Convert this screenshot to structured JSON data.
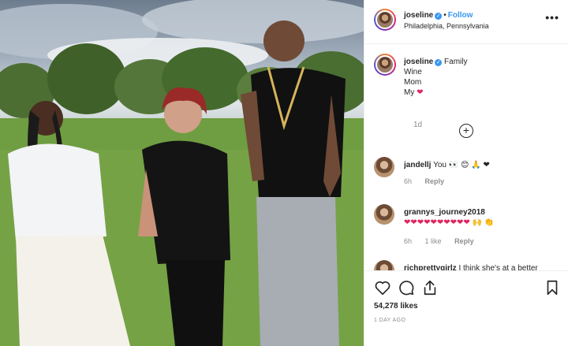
{
  "post": {
    "username": "joseline",
    "follow_label": "Follow",
    "location": "Philadelphia, Pennsylvania",
    "more_icon": "more-horizontal-icon",
    "verified_icon": "verified-badge-icon"
  },
  "caption": {
    "username": "joseline",
    "lines": [
      "Family",
      "Wine",
      "Mom",
      "My"
    ],
    "heart": "❤",
    "time": "1d",
    "load_more_icon": "plus-circle-icon"
  },
  "comments": [
    {
      "username": "jandellj",
      "text": "You 👀 😊 🙏 ❤",
      "time": "6h",
      "likes": "",
      "reply_label": "Reply"
    },
    {
      "username": "grannys_journey2018",
      "text": "❤❤❤❤❤❤❤❤❤❤ 🙌 👏",
      "time": "6h",
      "likes": "1 like",
      "reply_label": "Reply"
    },
    {
      "username": "richprettygirlz",
      "text": "I think she's at a better",
      "time": "",
      "likes": "",
      "reply_label": ""
    }
  ],
  "actions": {
    "like_icon": "heart-outline-icon",
    "comment_icon": "comment-icon",
    "share_icon": "share-icon",
    "save_icon": "bookmark-icon",
    "likes_count": "54,278 likes",
    "posted_ago": "1 DAY AGO"
  },
  "colors": {
    "link_blue": "#3897f0",
    "text": "#262626",
    "muted": "#8e8e8e",
    "heart_red": "#e0245e"
  }
}
